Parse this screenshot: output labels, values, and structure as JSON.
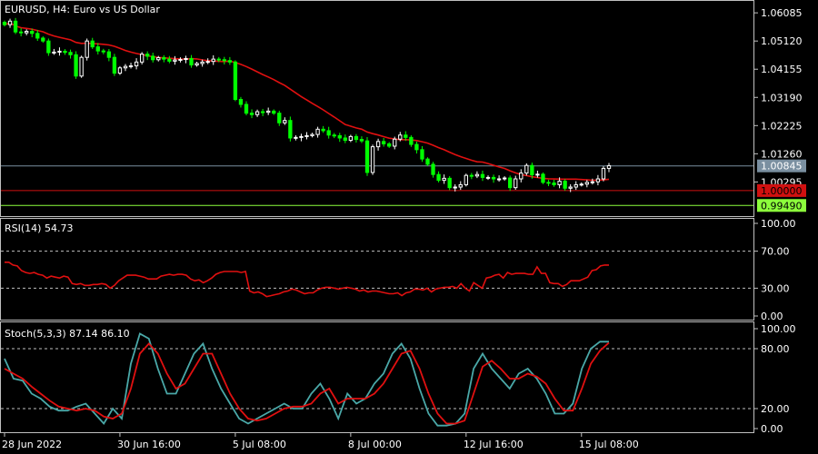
{
  "colors": {
    "background": "#000000",
    "frame": "#c0c0c0",
    "candle_bull": "#ffffff",
    "candle_bear": "#00ff00",
    "ma": "#e01010",
    "rsi": "#e01010",
    "stoch_main": "#4aa8a8",
    "stoch_signal": "#e01010",
    "price_line": "#7a8fa0",
    "level_1": "#d01010",
    "level_2": "#8cff3c"
  },
  "chart_data": [
    {
      "type": "candlestick",
      "title": "EURUSD, H4:  Euro vs US Dollar",
      "ylim": [
        0.9925,
        1.064
      ],
      "y_ticks": [
        "1.06085",
        "1.05120",
        "1.04155",
        "1.03190",
        "1.02225",
        "1.01260",
        "1.00295"
      ],
      "x_tick_labels": [
        "28 Jun 2022",
        "30 Jun 16:00",
        "5 Jul 08:00",
        "8 Jul 00:00",
        "12 Jul 16:00",
        "15 Jul 08:00"
      ],
      "x_tick_index": [
        0,
        21,
        42,
        63,
        84,
        105
      ],
      "closes": [
        1.0568,
        1.058,
        1.0543,
        1.054,
        1.0545,
        1.0538,
        1.0522,
        1.0512,
        1.0472,
        1.0474,
        1.0477,
        1.0473,
        1.0465,
        1.0392,
        1.0456,
        1.0512,
        1.0492,
        1.0478,
        1.0475,
        1.0456,
        1.0402,
        1.042,
        1.0425,
        1.0427,
        1.044,
        1.0467,
        1.046,
        1.0448,
        1.0455,
        1.045,
        1.0443,
        1.0447,
        1.0449,
        1.0452,
        1.043,
        1.0435,
        1.044,
        1.0442,
        1.045,
        1.0448,
        1.0445,
        1.044,
        1.0312,
        1.0295,
        1.0265,
        1.026,
        1.027,
        1.0268,
        1.0272,
        1.0265,
        1.0232,
        1.024,
        1.018,
        1.0182,
        1.0185,
        1.0188,
        1.0192,
        1.021,
        1.0205,
        1.019,
        1.0188,
        1.018,
        1.0172,
        1.0185,
        1.0175,
        1.017,
        1.0062,
        1.015,
        1.0168,
        1.016,
        1.0152,
        1.0176,
        1.019,
        1.0182,
        1.0158,
        1.014,
        1.0108,
        1.009,
        1.0055,
        1.0035,
        1.0042,
        1.001,
        1.0012,
        1.002,
        1.0052,
        1.005,
        1.0055,
        1.0045,
        1.0045,
        1.004,
        1.004,
        1.0043,
        1.001,
        1.004,
        1.006,
        1.0086,
        1.0054,
        1.0056,
        1.0028,
        1.0026,
        1.002,
        1.0032,
        1.0008,
        1.0012,
        1.002,
        1.0022,
        1.0028,
        1.003,
        1.004,
        1.0076,
        1.0085
      ],
      "price_line": {
        "value": 1.00845,
        "label": "1.00845"
      },
      "levels": [
        {
          "value": 1.0,
          "label": "1.00000",
          "color": "#d01010"
        },
        {
          "value": 0.9949,
          "label": "0.99490",
          "color": "#8cff3c"
        }
      ]
    },
    {
      "type": "line",
      "title": "RSI(14) 54.73",
      "ylim": [
        0,
        100
      ],
      "y_ticks": [
        "100.00",
        "70.00",
        "30.00",
        "0.00"
      ],
      "levels": [
        70,
        30
      ],
      "values": [
        58,
        58,
        55,
        54,
        49,
        47,
        46,
        47,
        45,
        44,
        41,
        43,
        42,
        41,
        43,
        42,
        35,
        34,
        35,
        33,
        33,
        34,
        34,
        35,
        34,
        30,
        33,
        38,
        41,
        44,
        44,
        44,
        43,
        42,
        40,
        40,
        40,
        43,
        44,
        45,
        44,
        45,
        45,
        44,
        40,
        38,
        39,
        36,
        38,
        41,
        45,
        47,
        48,
        48,
        48,
        48,
        47,
        48,
        27,
        25,
        26,
        24,
        21,
        22,
        23,
        24,
        26,
        27,
        29,
        28,
        26,
        24,
        25,
        25,
        28,
        30,
        31,
        31,
        30,
        29,
        30,
        31,
        30,
        29,
        27,
        28,
        26,
        27,
        27,
        26,
        25,
        24,
        24,
        25,
        22,
        25,
        26,
        29,
        29,
        28,
        30,
        26,
        29,
        30,
        31,
        31,
        32,
        30,
        35,
        30,
        27,
        36,
        33,
        30,
        41,
        42,
        44,
        45,
        41,
        47,
        45,
        46,
        46,
        46,
        45,
        45,
        53,
        46,
        46,
        36,
        35,
        35,
        32,
        34,
        38,
        38,
        38,
        40,
        42,
        49,
        50,
        54,
        55,
        55
      ]
    },
    {
      "type": "line",
      "title": "Stoch(5,3,3) 87.14 86.10",
      "ylim": [
        0,
        100
      ],
      "y_ticks": [
        "100.00",
        "80.00",
        "20.00",
        "0.00"
      ],
      "levels": [
        80,
        20
      ],
      "series": [
        {
          "name": "main",
          "values": [
            70,
            50,
            48,
            35,
            30,
            22,
            18,
            18,
            22,
            25,
            15,
            5,
            20,
            10,
            65,
            95,
            90,
            60,
            35,
            35,
            55,
            75,
            85,
            60,
            40,
            25,
            10,
            5,
            10,
            15,
            20,
            25,
            20,
            20,
            35,
            45,
            30,
            10,
            35,
            25,
            30,
            45,
            55,
            75,
            85,
            70,
            40,
            15,
            3,
            3,
            5,
            15,
            60,
            75,
            60,
            50,
            40,
            55,
            60,
            50,
            35,
            15,
            15,
            25,
            60,
            80,
            87,
            87
          ]
        },
        {
          "name": "signal",
          "values": [
            60,
            55,
            50,
            42,
            35,
            28,
            22,
            20,
            18,
            20,
            18,
            12,
            10,
            15,
            40,
            75,
            85,
            75,
            55,
            40,
            45,
            60,
            75,
            75,
            55,
            35,
            20,
            10,
            8,
            10,
            15,
            20,
            22,
            22,
            25,
            35,
            40,
            25,
            30,
            30,
            30,
            35,
            45,
            60,
            75,
            78,
            60,
            35,
            15,
            5,
            5,
            8,
            35,
            62,
            68,
            60,
            50,
            50,
            55,
            52,
            45,
            30,
            18,
            18,
            40,
            65,
            78,
            86
          ]
        }
      ]
    }
  ]
}
